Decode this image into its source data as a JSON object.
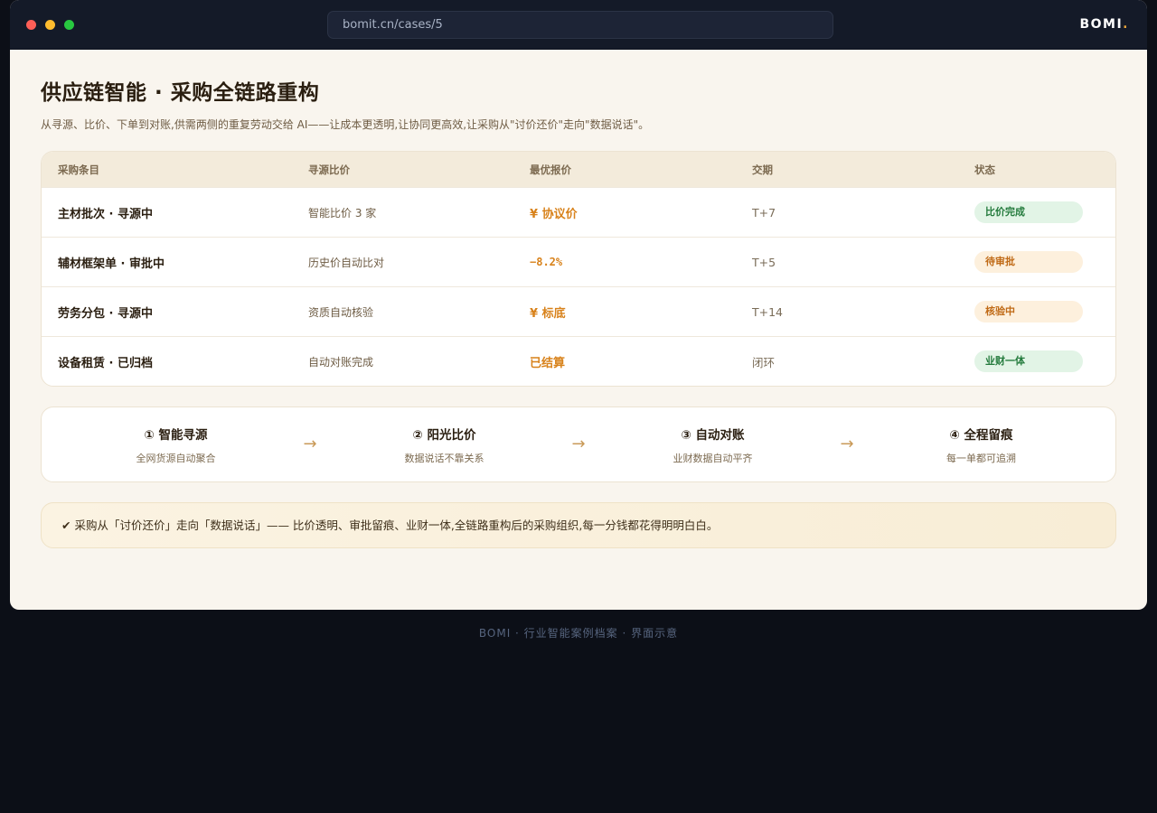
{
  "browser": {
    "url": "bomit.cn/cases/5",
    "brand": "BOMI",
    "brand_accent": "."
  },
  "page": {
    "title": "供应链智能 · 采购全链路重构",
    "subtitle": "从寻源、比价、下单到对账,供需两侧的重复劳动交给 AI——让成本更透明,让协同更高效,让采购从\"讨价还价\"走向\"数据说话\"。"
  },
  "table": {
    "headers": [
      "采购条目",
      "寻源比价",
      "最优报价",
      "交期",
      "状态"
    ],
    "rows": [
      {
        "item": "主材批次 · 寻源中",
        "source": "智能比价 3 家",
        "price": "¥ 协议价",
        "lead": "T+7",
        "status": "比价完成",
        "status_color": "green"
      },
      {
        "item": "辅材框架单 · 审批中",
        "source": "历史价自动比对",
        "price": "−8.2%",
        "lead": "T+5",
        "status": "待审批",
        "status_color": "orange"
      },
      {
        "item": "劳务分包 · 寻源中",
        "source": "资质自动核验",
        "price": "¥ 标底",
        "lead": "T+14",
        "status": "核验中",
        "status_color": "orange"
      },
      {
        "item": "设备租赁 · 已归档",
        "source": "自动对账完成",
        "price": "已结算",
        "lead": "闭环",
        "status": "业财一体",
        "status_color": "green"
      }
    ]
  },
  "flow": {
    "steps": [
      {
        "title": "① 智能寻源",
        "desc": "全网货源自动聚合"
      },
      {
        "title": "② 阳光比价",
        "desc": "数据说话不靠关系"
      },
      {
        "title": "③ 自动对账",
        "desc": "业财数据自动平齐"
      },
      {
        "title": "④ 全程留痕",
        "desc": "每一单都可追溯"
      }
    ],
    "arrow": "→"
  },
  "note": "✔ 采购从「讨价还价」走向「数据说话」—— 比价透明、审批留痕、业财一体,全链路重构后的采购组织,每一分钱都花得明明白白。",
  "footer": "BOMI · 行业智能案例档案 · 界面示意",
  "colors": {
    "accent": "#d8821b",
    "titlebar": "#141a28",
    "page_bg": "#f9f5ee",
    "badge_green": "#237a3c",
    "badge_orange": "#c06a16"
  }
}
